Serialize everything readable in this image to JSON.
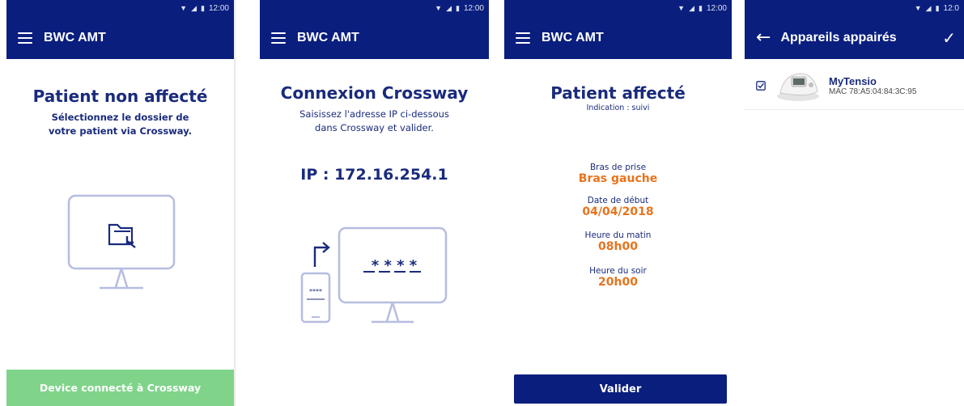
{
  "status": {
    "time": "12:00",
    "time_cut": "12:0"
  },
  "screen1": {
    "app_title": "BWC AMT",
    "heading": "Patient non affecté",
    "subtitle_line1": "Sélectionnez le dossier de",
    "subtitle_line2": "votre patient via Crossway.",
    "icon": "monitor-folder-icon",
    "button": "Device connecté à Crossway"
  },
  "screen2": {
    "app_title": "BWC AMT",
    "heading": "Connexion Crossway",
    "subtitle_line1": "Saisissez l'adresse IP ci-dessous",
    "subtitle_line2": "dans Crossway et valider.",
    "ip": "IP : 172.16.254.1",
    "monitor_code": "* * * *",
    "phone_code": "****",
    "icon": "phone-to-monitor-icon"
  },
  "screen3": {
    "app_title": "BWC AMT",
    "heading": "Patient affecté",
    "indication": "Indication : suivi",
    "fields": [
      {
        "label": "Bras de prise",
        "value": "Bras gauche"
      },
      {
        "label": "Date de début",
        "value": "04/04/2018"
      },
      {
        "label": "Heure du matin",
        "value": "08h00"
      },
      {
        "label": "Heure du soir",
        "value": "20h00"
      }
    ],
    "button": "Valider"
  },
  "screen4": {
    "app_title": "Appareils appairés",
    "device": {
      "name": "MyTensio",
      "mac": "MAC 78:A5:04:84:3C:95"
    }
  },
  "colors": {
    "primary": "#0a1e7e",
    "accent": "#e8731c",
    "success": "#7fd48a",
    "illustration": "#b6bde0"
  }
}
